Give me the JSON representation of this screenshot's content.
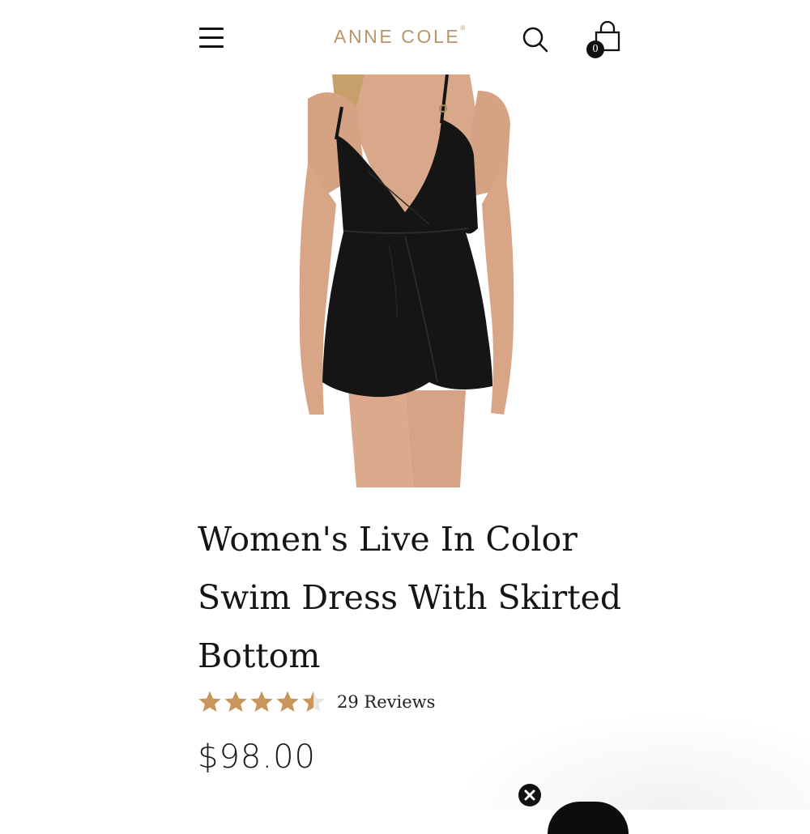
{
  "header": {
    "brand": "ANNE COLE",
    "brand_mark": "®",
    "cart_count": "0",
    "icons": [
      "hamburger-menu-icon",
      "search-icon",
      "shopping-bag-icon"
    ],
    "brand_color": "#b8956a"
  },
  "product": {
    "image_alt": "Black wrap-style swim dress with skirted bottom and thin straps",
    "title": "Women's Live In Color Swim Dress With Skirted Bottom",
    "rating": 4.5,
    "rating_max": 5,
    "star_color": "#c9955c",
    "reviews_label": "29 Reviews",
    "price": "$98.00"
  },
  "popup": {
    "close_icon": "close-icon"
  }
}
